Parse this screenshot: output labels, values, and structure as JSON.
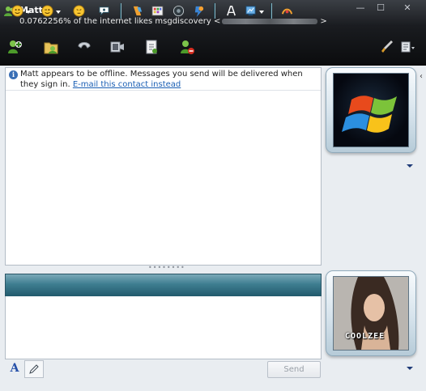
{
  "window": {
    "contact_name": "Matt",
    "personal_message": "0.0762256% of the internet likes msgdiscovery <",
    "personal_message_end": ">",
    "controls": {
      "minimize": "—",
      "maximize": "☐",
      "close": "✕"
    }
  },
  "toolbar": {
    "items": [
      {
        "name": "invite-contact-icon"
      },
      {
        "name": "send-files-icon"
      },
      {
        "name": "voice-call-icon"
      },
      {
        "name": "video-call-icon"
      },
      {
        "name": "share-folder-icon"
      },
      {
        "name": "block-contact-icon"
      },
      {
        "name": "paint-brush-icon"
      },
      {
        "name": "menu-icon"
      }
    ]
  },
  "conversation": {
    "offline_notice": "Matt appears to be offline. Messages you send will be delivered when they sign in.",
    "email_link": "E-mail this contact instead"
  },
  "emoticon_bar": {
    "items": [
      "smiley-icon",
      "wink-icon",
      "nudge-icon",
      "voice-clip-icon",
      "background-icon",
      "games-icon",
      "activities-icon",
      "winks-icon",
      "font-icon",
      "handwriting-icon",
      "ink-icon"
    ]
  },
  "input": {
    "send_label": "Send",
    "format_font_label": "A"
  },
  "display_pictures": {
    "contact_logo": "windows-logo",
    "self_caption": "COOLZEE"
  },
  "colors": {
    "header_bg": "#0b0c0e",
    "emoticon_bar": "#3e7d90",
    "link": "#1a5fb4"
  }
}
